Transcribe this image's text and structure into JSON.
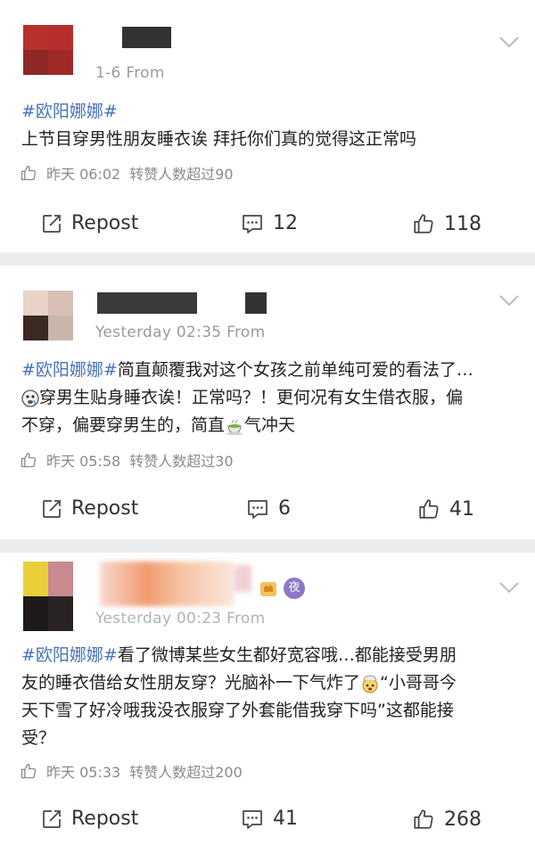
{
  "posts": [
    {
      "meta": "1-6 From",
      "hashtag": "#欧阳娜娜#",
      "lines": [
        "上节目穿男性朋友睡衣诶 拜托你们真的觉得这正常吗"
      ],
      "time": "昨天 06:02",
      "likes_note": "转赞人数超过90",
      "repost_label": "Repost",
      "comments": "12",
      "likes": "118"
    },
    {
      "meta": "Yesterday 02:35 From",
      "hashtag": "#欧阳娜娜#",
      "line1_rest": "简直颠覆我对这个女孩之前单纯可爱的看法了…",
      "line2": "穿男生贴身睡衣诶！正常吗？！更何况有女生借衣服，偏",
      "line3_a": "不穿，偏要穿男生的，简直",
      "line3_b": "气冲天",
      "time": "昨天 05:58",
      "likes_note": "转赞人数超过30",
      "repost_label": "Repost",
      "comments": "6",
      "likes": "41"
    },
    {
      "meta": "Yesterday 00:23 From",
      "badge_text": "夜",
      "hashtag": "#欧阳娜娜#",
      "line1_rest": "看了微博某些女生都好宽容哦…都能接受男朋",
      "line2_a": "友的睡衣借给女性朋友穿？光脑补一下气炸了",
      "line2_b": "“小哥哥今",
      "line3": "天下雪了好冷哦我没衣服穿了外套能借我穿下吗”这都能接",
      "line4": "受？",
      "time": "昨天 05:33",
      "likes_note": "转赞人数超过200",
      "repost_label": "Repost",
      "comments": "41",
      "likes": "268"
    }
  ],
  "colors": {
    "hashtag": "#4a72b8",
    "background": "#ececec",
    "card": "#ffffff",
    "meta": "#9a9a9a"
  },
  "icons": [
    "chevron-down-icon",
    "thumb-up-icon",
    "repost-icon",
    "comment-icon",
    "hot-tea-emoji",
    "exploding-head-emoji",
    "sleepy-emoji"
  ]
}
